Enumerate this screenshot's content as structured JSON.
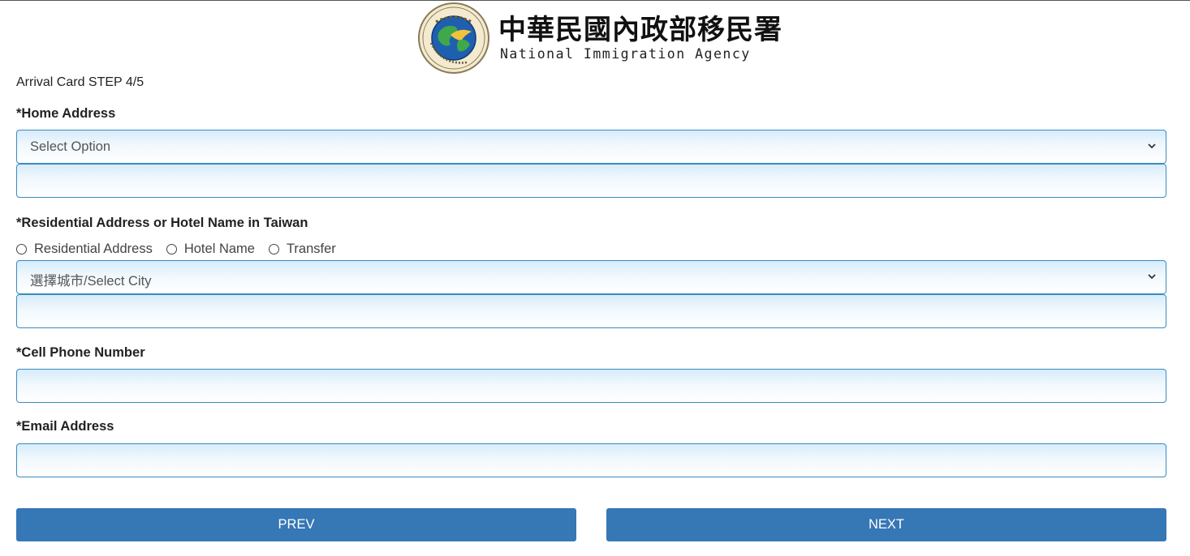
{
  "header": {
    "agency_name_zh": "中華民國內政部移民署",
    "agency_name_en": "National Immigration Agency",
    "logo_icon": "nia-seal-icon"
  },
  "form": {
    "step_title": "Arrival Card STEP 4/5",
    "home_address": {
      "label": "*Home Address",
      "select_value": "Select Option",
      "input_value": ""
    },
    "residential": {
      "label": "*Residential Address or Hotel Name in Taiwan",
      "options": [
        "Residential Address",
        "Hotel Name",
        "Transfer"
      ],
      "city_select_value": "選擇城市/Select City",
      "input_value": ""
    },
    "cell_phone": {
      "label": "*Cell Phone Number",
      "input_value": ""
    },
    "email": {
      "label": "*Email Address",
      "input_value": ""
    }
  },
  "buttons": {
    "prev_label": "PREV",
    "next_label": "NEXT"
  },
  "colors": {
    "field_border": "#3a8bbf",
    "button_bg": "#3677b5",
    "field_gradient_top": "#d6ecfb"
  }
}
